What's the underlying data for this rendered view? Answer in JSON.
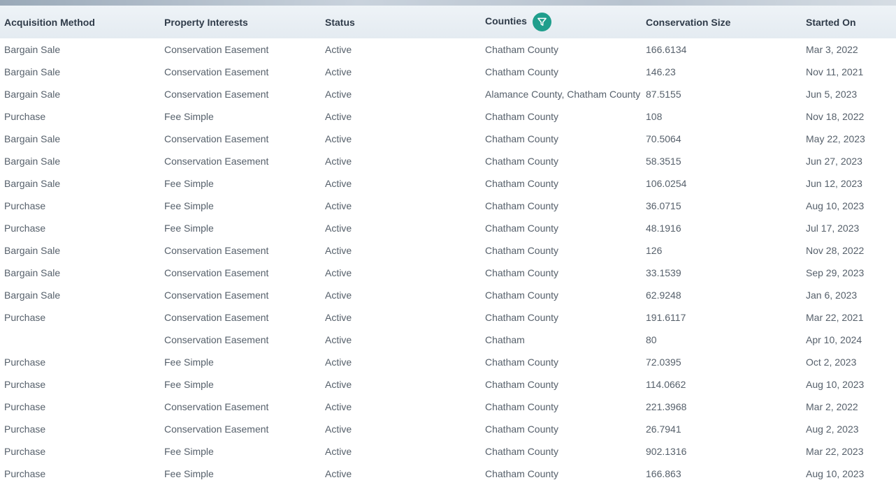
{
  "table": {
    "headers": {
      "acquisition_method": "Acquisition Method",
      "property_interests": "Property Interests",
      "status": "Status",
      "counties": "Counties",
      "conservation_size": "Conservation Size",
      "started_on": "Started On"
    },
    "filter_icon": "filter-funnel-icon",
    "accent_color": "#1f9e8c",
    "rows": [
      [
        "Bargain Sale",
        "Conservation Easement",
        "Active",
        "Chatham County",
        "166.6134",
        "Mar 3, 2022"
      ],
      [
        "Bargain Sale",
        "Conservation Easement",
        "Active",
        "Chatham County",
        "146.23",
        "Nov 11, 2021"
      ],
      [
        "Bargain Sale",
        "Conservation Easement",
        "Active",
        "Alamance County, Chatham County",
        "87.5155",
        "Jun 5, 2023"
      ],
      [
        "Purchase",
        "Fee Simple",
        "Active",
        "Chatham County",
        "108",
        "Nov 18, 2022"
      ],
      [
        "Bargain Sale",
        "Conservation Easement",
        "Active",
        "Chatham County",
        "70.5064",
        "May 22, 2023"
      ],
      [
        "Bargain Sale",
        "Conservation Easement",
        "Active",
        "Chatham County",
        "58.3515",
        "Jun 27, 2023"
      ],
      [
        "Bargain Sale",
        "Fee Simple",
        "Active",
        "Chatham County",
        "106.0254",
        "Jun 12, 2023"
      ],
      [
        "Purchase",
        "Fee Simple",
        "Active",
        "Chatham County",
        "36.0715",
        "Aug 10, 2023"
      ],
      [
        "Purchase",
        "Fee Simple",
        "Active",
        "Chatham County",
        "48.1916",
        "Jul 17, 2023"
      ],
      [
        "Bargain Sale",
        "Conservation Easement",
        "Active",
        "Chatham County",
        "126",
        "Nov 28, 2022"
      ],
      [
        "Bargain Sale",
        "Conservation Easement",
        "Active",
        "Chatham County",
        "33.1539",
        "Sep 29, 2023"
      ],
      [
        "Bargain Sale",
        "Conservation Easement",
        "Active",
        "Chatham County",
        "62.9248",
        "Jan 6, 2023"
      ],
      [
        "Purchase",
        "Conservation Easement",
        "Active",
        "Chatham County",
        "191.6117",
        "Mar 22, 2021"
      ],
      [
        "",
        "Conservation Easement",
        "Active",
        "Chatham",
        "80",
        "Apr 10, 2024"
      ],
      [
        "Purchase",
        "Fee Simple",
        "Active",
        "Chatham County",
        "72.0395",
        "Oct 2, 2023"
      ],
      [
        "Purchase",
        "Fee Simple",
        "Active",
        "Chatham County",
        "114.0662",
        "Aug 10, 2023"
      ],
      [
        "Purchase",
        "Conservation Easement",
        "Active",
        "Chatham County",
        "221.3968",
        "Mar 2, 2022"
      ],
      [
        "Purchase",
        "Conservation Easement",
        "Active",
        "Chatham County",
        "26.7941",
        "Aug 2, 2023"
      ],
      [
        "Purchase",
        "Fee Simple",
        "Active",
        "Chatham County",
        "902.1316",
        "Mar 22, 2023"
      ],
      [
        "Purchase",
        "Fee Simple",
        "Active",
        "Chatham County",
        "166.863",
        "Aug 10, 2023"
      ]
    ]
  }
}
